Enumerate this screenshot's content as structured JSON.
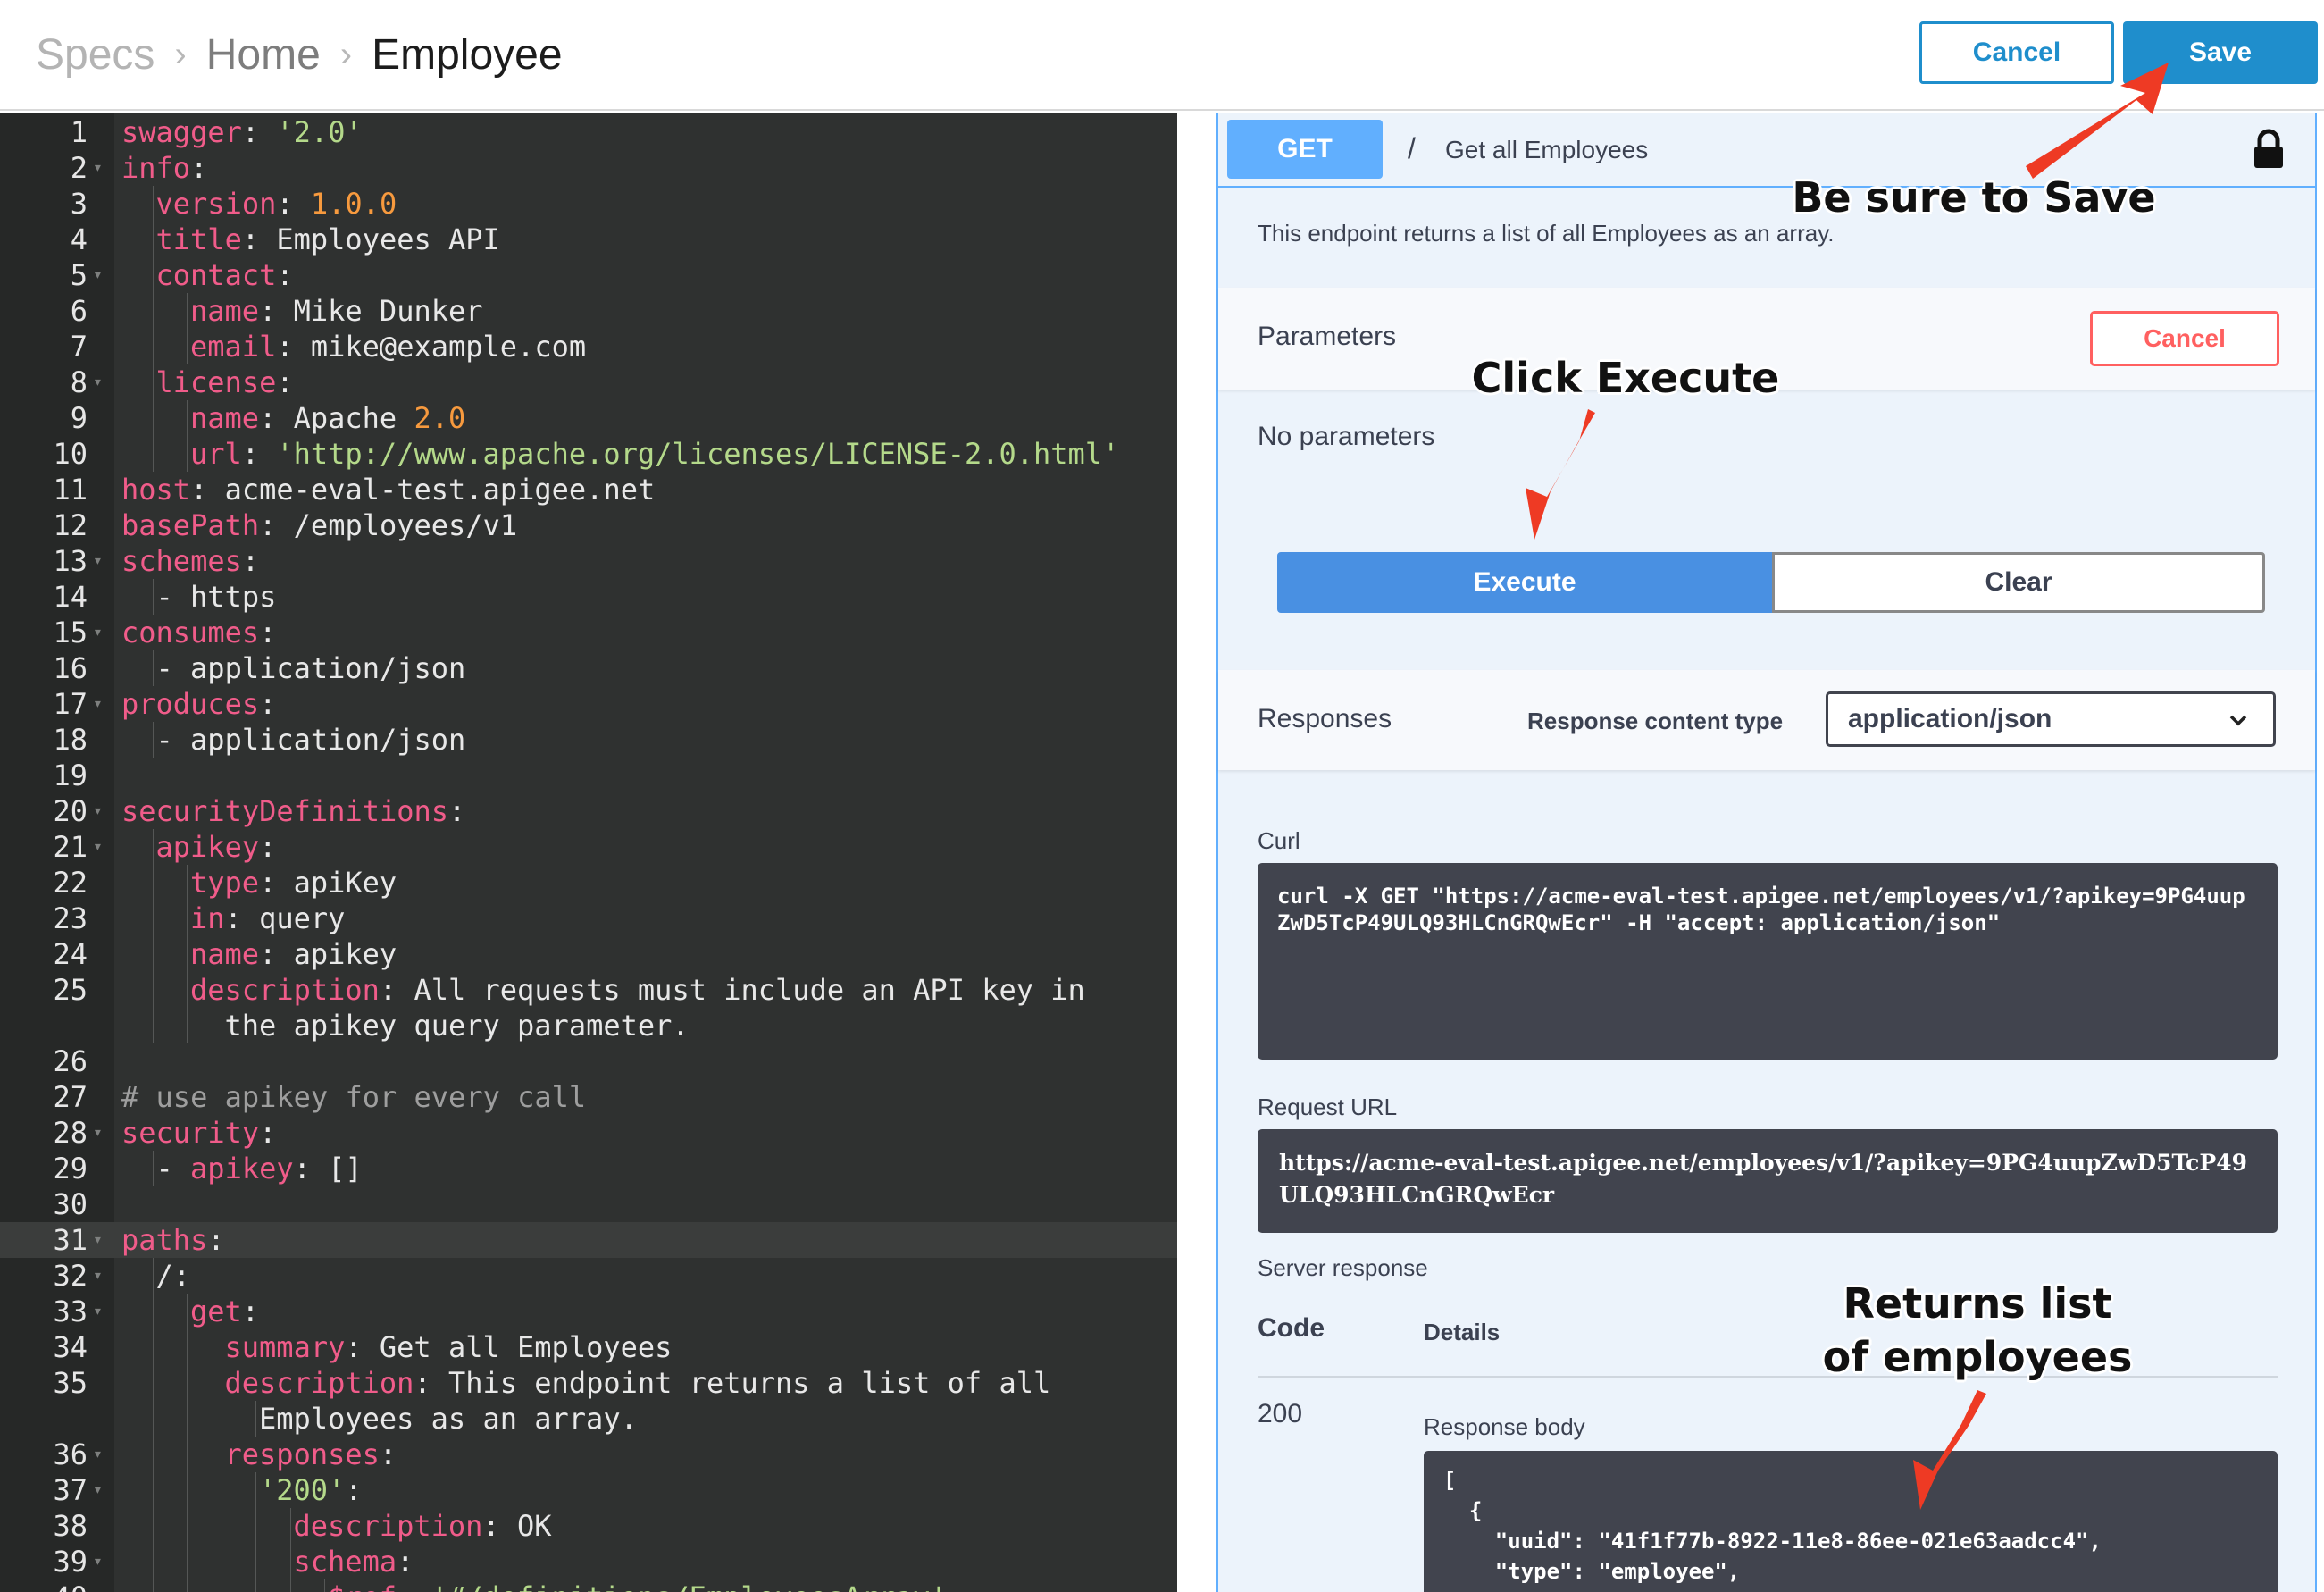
{
  "breadcrumb": {
    "root": "Specs",
    "middle": "Home",
    "current": "Employee",
    "separator": "›"
  },
  "toolbar": {
    "cancel_label": "Cancel",
    "save_label": "Save"
  },
  "editor": {
    "lines": [
      {
        "n": "1",
        "fold": false,
        "indent": 0,
        "t": [
          [
            "k",
            "swagger"
          ],
          [
            "p",
            ": "
          ],
          [
            "s",
            "'2.0'"
          ]
        ]
      },
      {
        "n": "2",
        "fold": true,
        "indent": 0,
        "t": [
          [
            "k",
            "info"
          ],
          [
            "p",
            ":"
          ]
        ]
      },
      {
        "n": "3",
        "fold": false,
        "indent": 1,
        "t": [
          [
            "k",
            "version"
          ],
          [
            "p",
            ": "
          ],
          [
            "n",
            "1.0.0"
          ]
        ]
      },
      {
        "n": "4",
        "fold": false,
        "indent": 1,
        "t": [
          [
            "k",
            "title"
          ],
          [
            "p",
            ": Employees API"
          ]
        ]
      },
      {
        "n": "5",
        "fold": true,
        "indent": 1,
        "t": [
          [
            "k",
            "contact"
          ],
          [
            "p",
            ":"
          ]
        ]
      },
      {
        "n": "6",
        "fold": false,
        "indent": 2,
        "t": [
          [
            "k",
            "name"
          ],
          [
            "p",
            ": Mike Dunker"
          ]
        ]
      },
      {
        "n": "7",
        "fold": false,
        "indent": 2,
        "t": [
          [
            "k",
            "email"
          ],
          [
            "p",
            ": mike@example.com"
          ]
        ]
      },
      {
        "n": "8",
        "fold": true,
        "indent": 1,
        "t": [
          [
            "k",
            "license"
          ],
          [
            "p",
            ":"
          ]
        ]
      },
      {
        "n": "9",
        "fold": false,
        "indent": 2,
        "t": [
          [
            "k",
            "name"
          ],
          [
            "p",
            ": Apache "
          ],
          [
            "n",
            "2.0"
          ]
        ]
      },
      {
        "n": "10",
        "fold": false,
        "indent": 2,
        "t": [
          [
            "k",
            "url"
          ],
          [
            "p",
            ": "
          ],
          [
            "s",
            "'http://www.apache.org/licenses/LICENSE-2.0.html'"
          ]
        ]
      },
      {
        "n": "11",
        "fold": false,
        "indent": 0,
        "t": [
          [
            "k",
            "host"
          ],
          [
            "p",
            ": acme-eval-test.apigee.net"
          ]
        ]
      },
      {
        "n": "12",
        "fold": false,
        "indent": 0,
        "t": [
          [
            "k",
            "basePath"
          ],
          [
            "p",
            ": /employees/v1"
          ]
        ]
      },
      {
        "n": "13",
        "fold": true,
        "indent": 0,
        "t": [
          [
            "k",
            "schemes"
          ],
          [
            "p",
            ":"
          ]
        ]
      },
      {
        "n": "14",
        "fold": false,
        "indent": 1,
        "t": [
          [
            "p",
            "- https"
          ]
        ]
      },
      {
        "n": "15",
        "fold": true,
        "indent": 0,
        "t": [
          [
            "k",
            "consumes"
          ],
          [
            "p",
            ":"
          ]
        ]
      },
      {
        "n": "16",
        "fold": false,
        "indent": 1,
        "t": [
          [
            "p",
            "- application/json"
          ]
        ]
      },
      {
        "n": "17",
        "fold": true,
        "indent": 0,
        "t": [
          [
            "k",
            "produces"
          ],
          [
            "p",
            ":"
          ]
        ]
      },
      {
        "n": "18",
        "fold": false,
        "indent": 1,
        "t": [
          [
            "p",
            "- application/json"
          ]
        ]
      },
      {
        "n": "19",
        "fold": false,
        "indent": 0,
        "t": []
      },
      {
        "n": "20",
        "fold": true,
        "indent": 0,
        "t": [
          [
            "k",
            "securityDefinitions"
          ],
          [
            "p",
            ":"
          ]
        ]
      },
      {
        "n": "21",
        "fold": true,
        "indent": 1,
        "t": [
          [
            "k",
            "apikey"
          ],
          [
            "p",
            ":"
          ]
        ]
      },
      {
        "n": "22",
        "fold": false,
        "indent": 2,
        "t": [
          [
            "k",
            "type"
          ],
          [
            "p",
            ": apiKey"
          ]
        ]
      },
      {
        "n": "23",
        "fold": false,
        "indent": 2,
        "t": [
          [
            "k",
            "in"
          ],
          [
            "p",
            ": query"
          ]
        ]
      },
      {
        "n": "24",
        "fold": false,
        "indent": 2,
        "t": [
          [
            "k",
            "name"
          ],
          [
            "p",
            ": apikey"
          ]
        ]
      },
      {
        "n": "25",
        "fold": false,
        "indent": 2,
        "t": [
          [
            "k",
            "description"
          ],
          [
            "p",
            ": All requests must include an API key in"
          ]
        ]
      },
      {
        "n": "",
        "fold": false,
        "indent": 3,
        "t": [
          [
            "p",
            "the apikey query parameter."
          ]
        ]
      },
      {
        "n": "26",
        "fold": false,
        "indent": 0,
        "t": []
      },
      {
        "n": "27",
        "fold": false,
        "indent": 0,
        "t": [
          [
            "c",
            "# use apikey for every call"
          ]
        ]
      },
      {
        "n": "28",
        "fold": true,
        "indent": 0,
        "t": [
          [
            "k",
            "security"
          ],
          [
            "p",
            ":"
          ]
        ]
      },
      {
        "n": "29",
        "fold": false,
        "indent": 1,
        "t": [
          [
            "p",
            "- "
          ],
          [
            "k",
            "apikey"
          ],
          [
            "p",
            ": []"
          ]
        ]
      },
      {
        "n": "30",
        "fold": false,
        "indent": 0,
        "t": []
      },
      {
        "n": "31",
        "fold": true,
        "indent": 0,
        "active": true,
        "t": [
          [
            "k",
            "paths"
          ],
          [
            "p",
            ":"
          ]
        ]
      },
      {
        "n": "32",
        "fold": true,
        "indent": 1,
        "t": [
          [
            "p",
            "/:"
          ]
        ]
      },
      {
        "n": "33",
        "fold": true,
        "indent": 2,
        "t": [
          [
            "k",
            "get"
          ],
          [
            "p",
            ":"
          ]
        ]
      },
      {
        "n": "34",
        "fold": false,
        "indent": 3,
        "t": [
          [
            "k",
            "summary"
          ],
          [
            "p",
            ": Get all Employees"
          ]
        ]
      },
      {
        "n": "35",
        "fold": false,
        "indent": 3,
        "t": [
          [
            "k",
            "description"
          ],
          [
            "p",
            ": This endpoint returns a list of all"
          ]
        ]
      },
      {
        "n": "",
        "fold": false,
        "indent": 4,
        "t": [
          [
            "p",
            "Employees as an array."
          ]
        ]
      },
      {
        "n": "36",
        "fold": true,
        "indent": 3,
        "t": [
          [
            "k",
            "responses"
          ],
          [
            "p",
            ":"
          ]
        ]
      },
      {
        "n": "37",
        "fold": true,
        "indent": 4,
        "t": [
          [
            "s",
            "'200'"
          ],
          [
            "p",
            ":"
          ]
        ]
      },
      {
        "n": "38",
        "fold": false,
        "indent": 5,
        "t": [
          [
            "k",
            "description"
          ],
          [
            "p",
            ": OK"
          ]
        ]
      },
      {
        "n": "39",
        "fold": true,
        "indent": 5,
        "t": [
          [
            "k",
            "schema"
          ],
          [
            "p",
            ":"
          ]
        ]
      },
      {
        "n": "40",
        "fold": false,
        "indent": 6,
        "t": [
          [
            "k",
            "$ref"
          ],
          [
            "p",
            ": "
          ],
          [
            "s",
            "'#/definitions/EmployeesArray'"
          ]
        ]
      }
    ]
  },
  "operation": {
    "method": "GET",
    "path": "/",
    "summary": "Get all Employees",
    "description": "This endpoint returns a list of all Employees as an array.",
    "parameters_title": "Parameters",
    "cancel_label": "Cancel",
    "no_parameters": "No parameters",
    "execute_label": "Execute",
    "clear_label": "Clear",
    "responses_title": "Responses",
    "response_content_type_label": "Response content type",
    "response_content_type_value": "application/json",
    "curl_label": "Curl",
    "curl_text": "curl -X GET \"https://acme-eval-test.apigee.net/employees/v1/?apikey=9PG4uupZwD5TcP49ULQ93HLCnGRQwEcr\" -H \"accept: application/json\"",
    "request_url_label": "Request URL",
    "request_url": "https://acme-eval-test.apigee.net/employees/v1/?apikey=9PG4uupZwD5TcP49ULQ93HLCnGRQwEcr",
    "server_response_label": "Server response",
    "code_header": "Code",
    "details_header": "Details",
    "status_code": "200",
    "response_body_label": "Response body",
    "response_body": "[\n  {\n    \"uuid\": \"41f1f77b-8922-11e8-86ee-021e63aadcc4\",\n    \"type\": \"employee\","
  },
  "annotations": {
    "save": "Be sure to Save",
    "execute": "Click Execute",
    "returns": "Returns list\nof employees"
  },
  "colors": {
    "accent": "#1f8ecc",
    "get": "#61affe",
    "danger": "#ff6060",
    "arrow": "#ee3a24"
  }
}
